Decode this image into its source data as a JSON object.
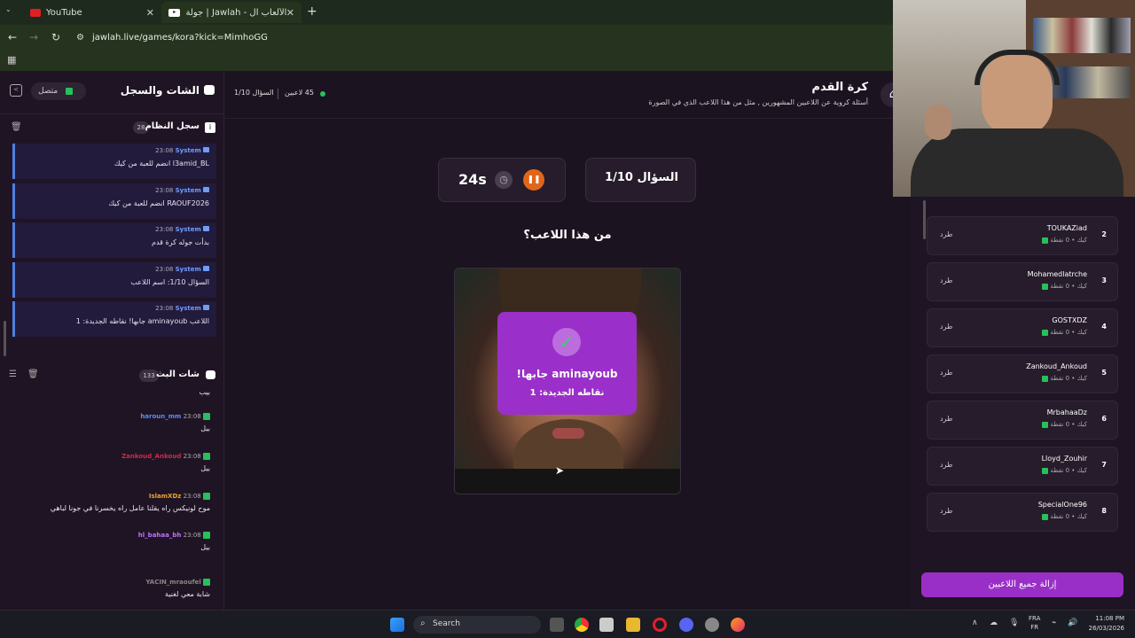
{
  "browser": {
    "tabs": [
      {
        "title": "YouTube"
      },
      {
        "title": "جولة | Jawlah - منصة الألعاب ال..."
      }
    ],
    "url": "jawlah.live/games/kora?kick=MimhoGG"
  },
  "chat_panel": {
    "title": "الشات والسجل",
    "status": "متصل",
    "system_log": {
      "title": "سجل النظام",
      "count": "28",
      "entries": [
        {
          "sender": "System",
          "time": "23:08",
          "text": "l3amid_BL انضم للعبة من كيك"
        },
        {
          "sender": "System",
          "time": "23:08",
          "text": "RAOUF2026 انضم للعبة من كيك"
        },
        {
          "sender": "System",
          "time": "23:08",
          "text": "بدأت جوله كرة قدم"
        },
        {
          "sender": "System",
          "time": "23:08",
          "text": "السؤال 1/10: اسم اللاعب"
        },
        {
          "sender": "System",
          "time": "23:08",
          "text": "اللاعب aminayoub جابها! نقاطه الجديدة: 1"
        }
      ]
    },
    "stream_chat": {
      "title": "شات البث",
      "count": "133",
      "messages": [
        {
          "user": "",
          "time": "",
          "text": "بيب",
          "color": "#cccccc"
        },
        {
          "user": "haroun_mm",
          "time": "23:08",
          "text": "بيل",
          "color": "#5a8cff"
        },
        {
          "user": "Zankoud_Ankoud",
          "time": "23:08",
          "text": "بيل",
          "color": "#d02a4a"
        },
        {
          "user": "IslamXDz",
          "time": "23:08",
          "text": "موح لونيكس راه يقلنا عامل راه يخسرنا في جونا لباهي",
          "color": "#f0a030"
        },
        {
          "user": "hl_bahaa_bh",
          "time": "23:08",
          "text": "بيل",
          "color": "#c070ff"
        },
        {
          "user": "YACIN_mraoufel",
          "time": "",
          "text": "شابة معي لغنية",
          "color": "#888888"
        }
      ]
    }
  },
  "game": {
    "title": "كرة القدم",
    "subtitle": "أسئلة كروية عن اللاعبين المشهورين , مثل من هذا اللاعب الذي في الصورة",
    "players_online": "45 لاعبين",
    "question_counter_small": "السؤال 1/10",
    "question_box": "السؤال 1/10",
    "timer": "24s",
    "question_text": "من هذا اللاعب؟",
    "correct_popup": {
      "line1": "aminayoub جابها!",
      "line2": "نقاطه الجديدة: 1"
    }
  },
  "players": {
    "kick_label": "طرد",
    "list": [
      {
        "rank": "2",
        "name": "TOUKAZiad",
        "sub": "كيك • 0 نقطة"
      },
      {
        "rank": "3",
        "name": "Mohamedlatrche",
        "sub": "كيك • 0 نقطة"
      },
      {
        "rank": "4",
        "name": "GOSTXDZ",
        "sub": "كيك • 0 نقطة"
      },
      {
        "rank": "5",
        "name": "Zankoud_Ankoud",
        "sub": "كيك • 0 نقطة"
      },
      {
        "rank": "6",
        "name": "MrbahaaDz",
        "sub": "كيك • 0 نقطة"
      },
      {
        "rank": "7",
        "name": "Lloyd_Zouhir",
        "sub": "كيك • 0 نقطة"
      },
      {
        "rank": "8",
        "name": "SpecialOne96",
        "sub": "كيك • 0 نقطة"
      }
    ],
    "remove_all": "إزالة جميع اللاعبين"
  },
  "taskbar": {
    "search": "Search",
    "lang1": "FRA",
    "lang2": "FR",
    "time": "11:08 PM",
    "date": "26/03/2026"
  },
  "colors": {
    "accent": "#9a2fc8",
    "kick_green": "#27c05a",
    "popup": "#9b2fc9"
  }
}
